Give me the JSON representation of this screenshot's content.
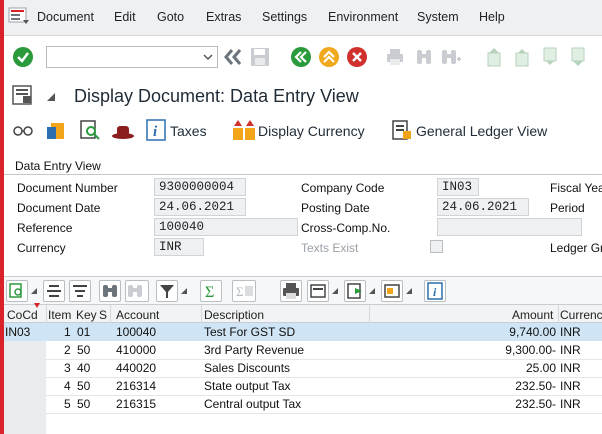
{
  "menu": {
    "items": [
      "Document",
      "Edit",
      "Goto",
      "Extras",
      "Settings",
      "Environment",
      "System",
      "Help"
    ]
  },
  "toolbar": {
    "command_field": {
      "value": "",
      "placeholder": ""
    }
  },
  "title": "Display Document: Data Entry View",
  "app_toolbar": {
    "taxes_label": "Taxes",
    "display_currency_label": "Display Currency",
    "general_ledger_view_label": "General Ledger View"
  },
  "header": {
    "group_title": "Data Entry View",
    "document_number_label": "Document Number",
    "document_number": "9300000004",
    "company_code_label": "Company Code",
    "company_code": "IN03",
    "fiscal_year_label": "Fiscal Year",
    "document_date_label": "Document Date",
    "document_date": "24.06.2021",
    "posting_date_label": "Posting Date",
    "posting_date": "24.06.2021",
    "period_label": "Period",
    "reference_label": "Reference",
    "reference": "100040",
    "cross_comp_label": "Cross-Comp.No.",
    "cross_comp": "",
    "currency_label": "Currency",
    "currency": "INR",
    "texts_exist_label": "Texts Exist",
    "ledger_group_label": "Ledger Gr"
  },
  "table": {
    "columns": [
      "CoCd",
      "Item",
      "Key",
      "S",
      "Account",
      "Description",
      "Amount",
      "Currency"
    ],
    "rows": [
      {
        "cocd": "IN03",
        "item": "1",
        "key": "01",
        "s": "",
        "account": "100040",
        "description": "Test For GST SD",
        "amount": "9,740.00",
        "currency": "INR"
      },
      {
        "cocd": "",
        "item": "2",
        "key": "50",
        "s": "",
        "account": "410000",
        "description": "3rd Party Revenue",
        "amount": "9,300.00-",
        "currency": "INR"
      },
      {
        "cocd": "",
        "item": "3",
        "key": "40",
        "s": "",
        "account": "440020",
        "description": "Sales Discounts",
        "amount": "25.00",
        "currency": "INR"
      },
      {
        "cocd": "",
        "item": "4",
        "key": "50",
        "s": "",
        "account": "216314",
        "description": "State output  Tax",
        "amount": "232.50-",
        "currency": "INR"
      },
      {
        "cocd": "",
        "item": "5",
        "key": "50",
        "s": "",
        "account": "216315",
        "description": "Central output  Tax",
        "amount": "232.50-",
        "currency": "INR"
      }
    ]
  },
  "colors": {
    "accent_red": "#d9222a",
    "selected_row": "#cfe4f4",
    "enter_green": "#2b9a3c",
    "back_green": "#2b9a3c",
    "exit_orange": "#f0a81c",
    "cancel_red": "#d0312d"
  }
}
